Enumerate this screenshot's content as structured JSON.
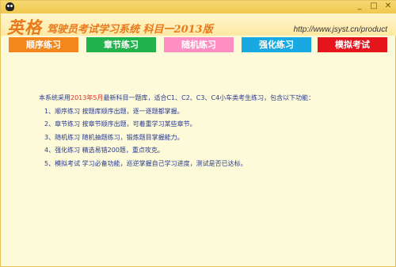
{
  "brand": "英格",
  "subtitle": "驾驶员考试学习系统 科目一2013版",
  "url": "http://www.jsyst.cn/product",
  "window_buttons": [
    "_",
    "□",
    "✕"
  ],
  "tabs": [
    {
      "label": "顺序练习",
      "color": "#f3861c"
    },
    {
      "label": "章节练习",
      "color": "#21b24b"
    },
    {
      "label": "随机练习",
      "color": "#ff8fc3"
    },
    {
      "label": "强化练习",
      "color": "#19a9e2"
    },
    {
      "label": "模拟考试",
      "color": "#e6141b"
    }
  ],
  "intro": {
    "before": "本系统采用",
    "highlight": "2013年5月",
    "after": "最新科目一题库，适合C1、C2、C3、C4小车类考生练习，包含以下功能："
  },
  "features": [
    "1、顺序练习  按题库顺序出题，逐一逐题都掌握。",
    "2、章节练习  按章节顺序出题，可着重学习某些章节。",
    "3、随机练习  随机抽题练习，锻炼题目掌握能力。",
    "4、强化练习  精选易错200题，重点攻克。",
    "5、模拟考试  学习必备功能，巡逆掌握自己学习进度，测试是否已达标。"
  ]
}
